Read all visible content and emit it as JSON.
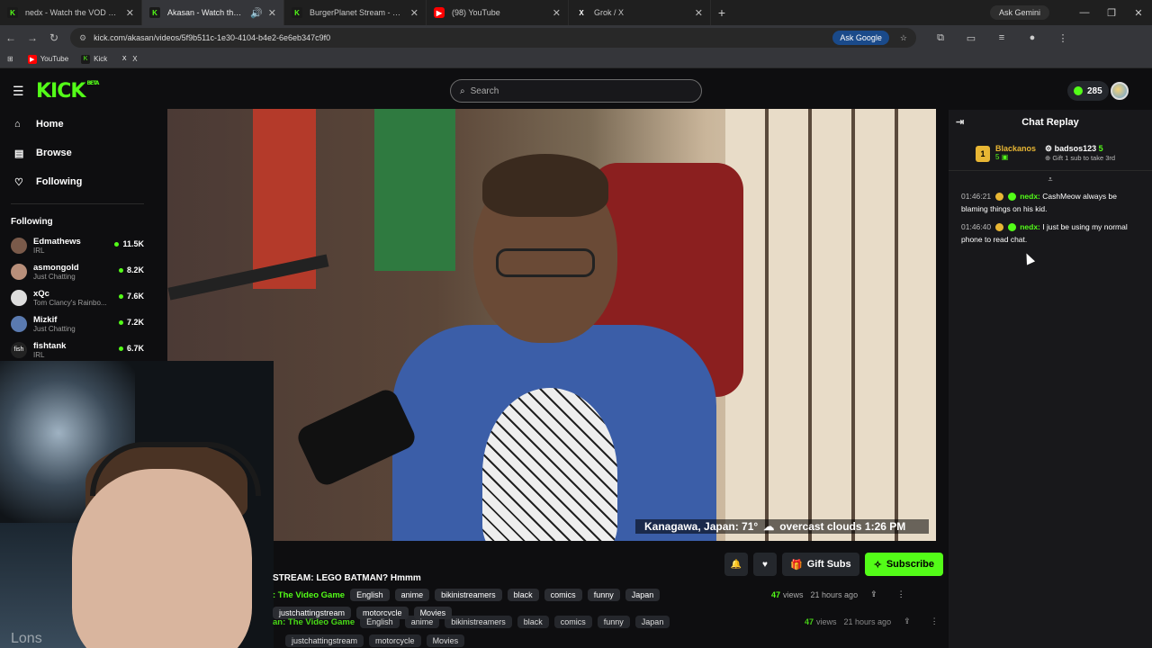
{
  "browser": {
    "tabs": [
      {
        "title": "nedx - Watch the VOD on Kick",
        "favicon": "kick-icon",
        "active": false
      },
      {
        "title": "Akasan - Watch the VOD on Kick",
        "favicon": "kick-icon",
        "active": true
      },
      {
        "title": "BurgerPlanet Stream - Watch L",
        "favicon": "kick-icon",
        "active": false
      },
      {
        "title": "(98) YouTube",
        "favicon": "youtube-icon",
        "active": false
      },
      {
        "title": "Grok / X",
        "favicon": "x-icon",
        "active": false
      }
    ],
    "ask_gemini": "Ask Gemini",
    "url": "kick.com/akasan/videos/5f9b511c-1e30-4104-b4e2-6e6eb347c9f0",
    "ask_google": "Ask Google",
    "bookmarks": [
      "YouTube",
      "Kick",
      "X"
    ]
  },
  "kick": {
    "logo": "KICK",
    "beta": "BETA",
    "search_placeholder": "Search",
    "points": "285",
    "accent": "#53fc18"
  },
  "sidebar": {
    "nav": [
      {
        "label": "Home",
        "icon": "home-icon"
      },
      {
        "label": "Browse",
        "icon": "browse-icon"
      },
      {
        "label": "Following",
        "icon": "heart-icon"
      }
    ],
    "following_title": "Following",
    "channels": [
      {
        "name": "Edmathews",
        "category": "IRL",
        "viewers": "11.5K"
      },
      {
        "name": "asmongold",
        "category": "Just Chatting",
        "viewers": "8.2K"
      },
      {
        "name": "xQc",
        "category": "Tom Clancy's Rainbo...",
        "viewers": "7.6K"
      },
      {
        "name": "Mizkif",
        "category": "Just Chatting",
        "viewers": "7.2K"
      },
      {
        "name": "fishtank",
        "category": "IRL",
        "viewers": "6.7K"
      }
    ]
  },
  "video": {
    "weather_overlay": "Kanagawa, Japan: 71°",
    "weather_condition": "overcast clouds 1:26 PM"
  },
  "webcam": {
    "overlay_text": "Lons"
  },
  "stream": {
    "title": "STREAM: LEGO BATMAN? Hmmm",
    "category": ": The Video Game",
    "category2": "an: The Video Game",
    "tags": [
      "English",
      "anime",
      "bikinistreamers",
      "black",
      "comics",
      "funny",
      "Japan"
    ],
    "tags_row2": [
      "justchattingstream",
      "motorcycle",
      "Movies"
    ],
    "views": "47",
    "views_label": "views",
    "time_ago": "21 hours ago",
    "gift_subs": "Gift Subs",
    "subscribe": "Subscribe"
  },
  "chat": {
    "title": "Chat Replay",
    "pinned": {
      "gifter": "Blackanos",
      "gifter_count": "5",
      "badge": "1",
      "recipient": "badsos123",
      "recipient_count": "5",
      "caption": "Gift 1 sub to take 3rd"
    },
    "messages": [
      {
        "time": "01:46:21",
        "user": "nedx:",
        "text": "CashMeow always be blaming things on his kid."
      },
      {
        "time": "01:46:40",
        "user": "nedx:",
        "text": "I just be using my normal phone to read chat."
      }
    ]
  }
}
